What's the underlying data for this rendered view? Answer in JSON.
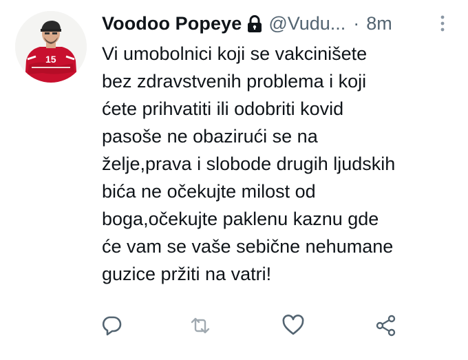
{
  "tweet": {
    "display_name": "Voodoo Popeye",
    "handle": "@Vudu...",
    "separator": "·",
    "time": "8m",
    "text": "Vi umobolnici koji se vakcinišete\nbez zdravstvenih problema i koji\nćete prihvatiti ili odobriti kovid\npasoše ne obazirući se na\nželje,prava i slobode drugih ljudskih\nbića ne očekujte milost od\nboga,očekujte paklenu kaznu gde\nće vam se vaše sebične nehumane\nguzice pržiti na vatri!"
  },
  "icons": {
    "lock": "lock-icon",
    "more": "more-icon",
    "reply": "reply-icon",
    "retweet": "retweet-icon",
    "like": "heart-icon",
    "share": "share-icon"
  },
  "colors": {
    "text_primary": "#0f1419",
    "text_secondary": "#536471",
    "background": "#ffffff",
    "jersey_red": "#c8102e"
  }
}
